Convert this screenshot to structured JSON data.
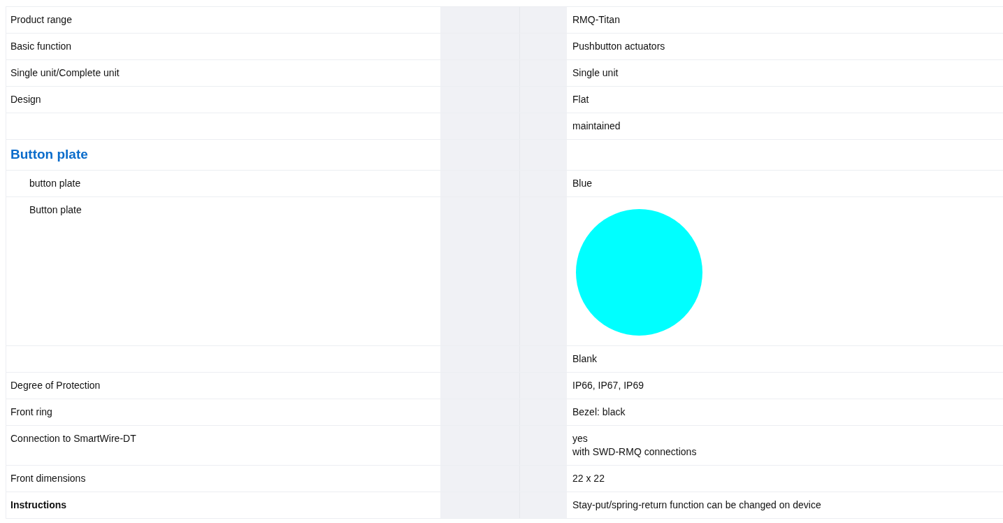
{
  "rows": [
    {
      "kind": "row",
      "label": "Product range",
      "value": [
        "RMQ-Titan"
      ]
    },
    {
      "kind": "row",
      "label": "Basic function",
      "value": [
        "Pushbutton actuators"
      ]
    },
    {
      "kind": "row",
      "label": "Single unit/Complete unit",
      "value": [
        "Single unit"
      ]
    },
    {
      "kind": "row",
      "label": "Design",
      "value": [
        "Flat"
      ]
    },
    {
      "kind": "row",
      "value": [
        "maintained"
      ]
    },
    {
      "kind": "heading",
      "label": "Button plate",
      "children": [
        {
          "kind": "row",
          "label": "button plate",
          "value": [
            "Blue"
          ]
        },
        {
          "kind": "swatch",
          "label": "Button plate",
          "color": "#00ffff"
        }
      ]
    },
    {
      "kind": "row",
      "value": [
        "Blank"
      ]
    },
    {
      "kind": "row",
      "label": "Degree of Protection",
      "value": [
        "IP66, IP67, IP69"
      ]
    },
    {
      "kind": "row",
      "label": "Front ring",
      "value": [
        "Bezel: black"
      ]
    },
    {
      "kind": "row",
      "label": "Connection to SmartWire-DT",
      "value": [
        "yes",
        "with SWD-RMQ connections"
      ]
    },
    {
      "kind": "row",
      "label": "Front dimensions",
      "value": [
        "22 x 22"
      ]
    },
    {
      "kind": "row",
      "label": "Instructions",
      "bold": true,
      "value": [
        "Stay-put/spring-return function can be changed on device"
      ]
    }
  ]
}
